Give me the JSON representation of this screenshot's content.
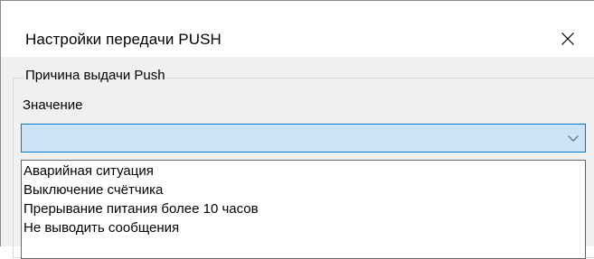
{
  "dialog": {
    "title": "Настройки передачи PUSH",
    "close_icon": "close-icon"
  },
  "group": {
    "legend": "Причина выдачи Push"
  },
  "field": {
    "label": "Значение",
    "selected_value": "",
    "arrow_icon": "chevron-down-icon"
  },
  "dropdown": {
    "options": [
      "Аварийная ситуация",
      "Выключение счётчика",
      "Прерывание питания более 10 часов",
      "Не выводить сообщения"
    ]
  },
  "colors": {
    "combo_fill": "#cce4f7",
    "combo_border": "#0078d7",
    "dialog_bg": "#f0f0f0",
    "titlebar_bg": "#ffffff"
  }
}
